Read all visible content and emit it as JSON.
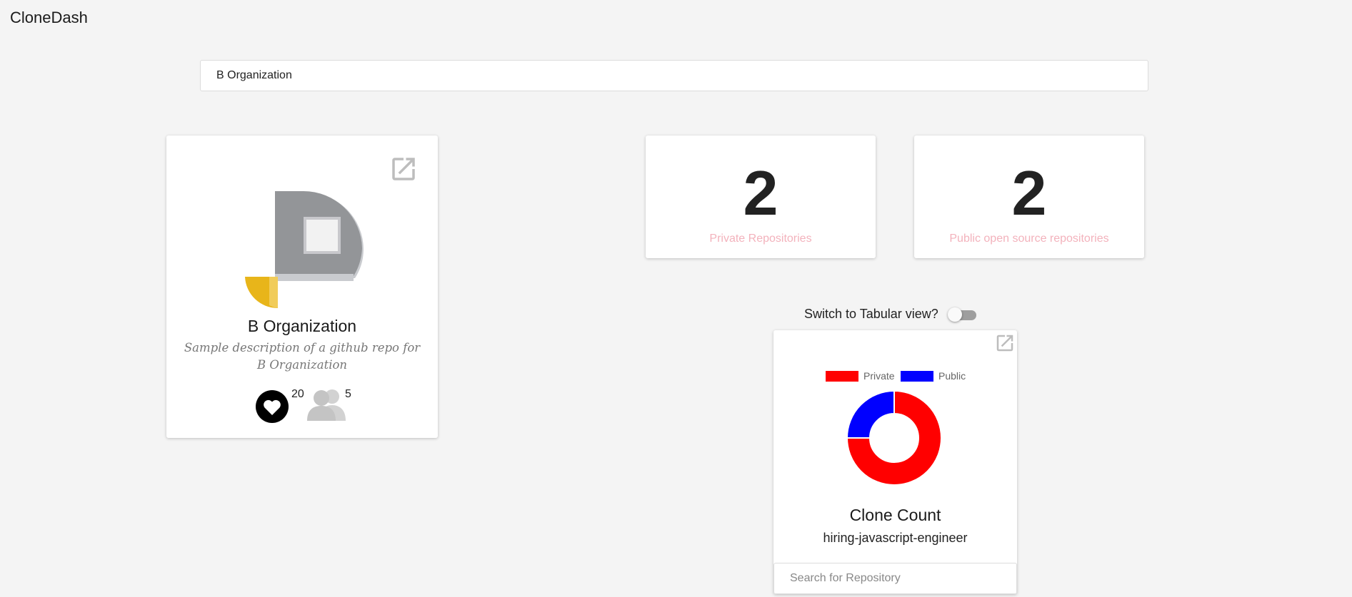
{
  "app": {
    "title": "CloneDash"
  },
  "search": {
    "value": "B Organization"
  },
  "org_card": {
    "name": "B Organization",
    "description": "Sample description of a github repo for B Organization",
    "likes": "20",
    "members": "5",
    "icons": [
      "external-link-icon",
      "org-logo",
      "heart-icon",
      "people-icon"
    ]
  },
  "stats": {
    "private": {
      "value": "2",
      "label": "Private Repositories"
    },
    "public": {
      "value": "2",
      "label": "Public open source repositories"
    },
    "label_color": "#f3b2bc"
  },
  "view_toggle": {
    "label": "Switch to Tabular view?",
    "checked": false
  },
  "clone_card": {
    "title": "Clone Count",
    "repo": "hiring-javascript-engineer",
    "search_placeholder": "Search for Repository",
    "chart_data": {
      "type": "pie",
      "categories": [
        "Private",
        "Public"
      ],
      "values": [
        3,
        1
      ],
      "colors": [
        "#ff0000",
        "#0000ff"
      ],
      "legend": "top"
    }
  }
}
